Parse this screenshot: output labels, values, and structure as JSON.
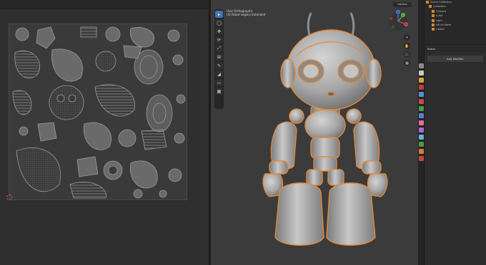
{
  "viewport": {
    "info_line1": "User Orthographic",
    "info_line2": "(4) Robot Legacy Extended",
    "view_menu": "Options",
    "tools": [
      "▸",
      "◯",
      "✥",
      "⟳",
      "⤢",
      "⊞",
      "✎",
      "◢",
      "▭",
      "▦"
    ],
    "nav": [
      "+",
      "✋",
      "🎥",
      "▦"
    ],
    "gizmo_axes": {
      "x": "X",
      "y": "Y",
      "z": "Z"
    },
    "accent_color": "#e08a3c",
    "active_tool_color": "#4772b3"
  },
  "outliner": {
    "items": [
      "Scene Collection",
      "Collection",
      "Camera",
      "Cube",
      "Light",
      "LW oil Mesh",
      "Object"
    ]
  },
  "properties": {
    "object_name": "Robot",
    "add_modifier_label": "Add Modifier",
    "tab_colors": [
      "#8a8a8a",
      "#c9c9c9",
      "#d9a33a",
      "#c43c3c",
      "#5a8fd6",
      "#c84a4a",
      "#4b9a4b",
      "#e06d9a",
      "#a86cd0",
      "#6aaed8",
      "#d97a3b",
      "#c5463c"
    ]
  }
}
